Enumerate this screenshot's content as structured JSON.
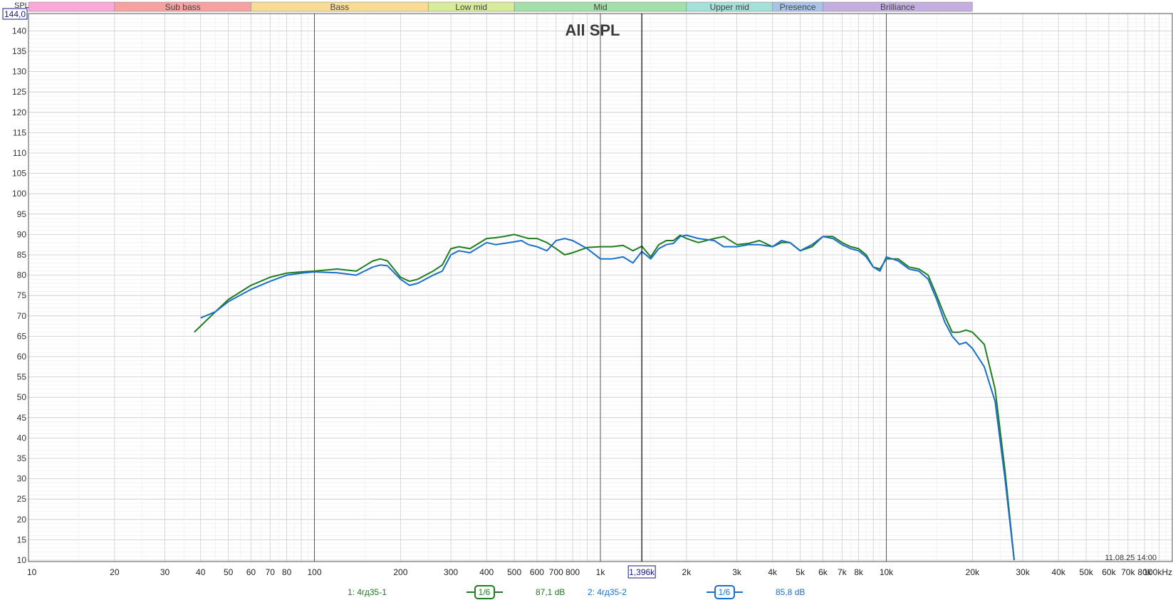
{
  "app": {
    "y_axis_name": "SPL",
    "y_cursor_readout": "144,0",
    "timestamp": "11.08.25 14:00"
  },
  "bands": [
    {
      "label": "",
      "from": 10,
      "to": 20,
      "color": "#f9a8d8"
    },
    {
      "label": "Sub bass",
      "from": 20,
      "to": 60,
      "color": "#f7a1a1"
    },
    {
      "label": "Bass",
      "from": 60,
      "to": 250,
      "color": "#f8dc95"
    },
    {
      "label": "Low mid",
      "from": 250,
      "to": 500,
      "color": "#d7ec9b"
    },
    {
      "label": "Mid",
      "from": 500,
      "to": 2000,
      "color": "#a3e0a9"
    },
    {
      "label": "Upper mid",
      "from": 2000,
      "to": 4000,
      "color": "#a5e0d8"
    },
    {
      "label": "Presence",
      "from": 4000,
      "to": 6000,
      "color": "#a9c3e8"
    },
    {
      "label": "Brilliance",
      "from": 6000,
      "to": 20000,
      "color": "#c3aedf"
    }
  ],
  "chart_data": {
    "type": "line",
    "title": "All SPL",
    "xlabel": "",
    "ylabel": "SPL",
    "x_scale": "log",
    "xlim": [
      10,
      100000
    ],
    "ylim": [
      10,
      144
    ],
    "grid": true,
    "x_ticks": [
      {
        "v": 10,
        "label": "10"
      },
      {
        "v": 20,
        "label": "20"
      },
      {
        "v": 30,
        "label": "30"
      },
      {
        "v": 40,
        "label": "40"
      },
      {
        "v": 50,
        "label": "50"
      },
      {
        "v": 60,
        "label": "60"
      },
      {
        "v": 70,
        "label": "70"
      },
      {
        "v": 80,
        "label": "80"
      },
      {
        "v": 100,
        "label": "100"
      },
      {
        "v": 200,
        "label": "200"
      },
      {
        "v": 300,
        "label": "300"
      },
      {
        "v": 400,
        "label": "400"
      },
      {
        "v": 500,
        "label": "500"
      },
      {
        "v": 600,
        "label": "600"
      },
      {
        "v": 700,
        "label": "700"
      },
      {
        "v": 800,
        "label": "800"
      },
      {
        "v": 1000,
        "label": "1k"
      },
      {
        "v": 2000,
        "label": "2k"
      },
      {
        "v": 3000,
        "label": "3k"
      },
      {
        "v": 4000,
        "label": "4k"
      },
      {
        "v": 5000,
        "label": "5k"
      },
      {
        "v": 6000,
        "label": "6k"
      },
      {
        "v": 7000,
        "label": "7k"
      },
      {
        "v": 8000,
        "label": "8k"
      },
      {
        "v": 10000,
        "label": "10k"
      },
      {
        "v": 20000,
        "label": "20k"
      },
      {
        "v": 30000,
        "label": "30k"
      },
      {
        "v": 40000,
        "label": "40k"
      },
      {
        "v": 50000,
        "label": "50k"
      },
      {
        "v": 60000,
        "label": "60k"
      },
      {
        "v": 70000,
        "label": "70k"
      },
      {
        "v": 80000,
        "label": "80k"
      },
      {
        "v": 100000,
        "label": "100kHz"
      }
    ],
    "y_ticks": [
      140,
      135,
      130,
      125,
      120,
      115,
      110,
      105,
      100,
      95,
      90,
      85,
      80,
      75,
      70,
      65,
      60,
      55,
      50,
      45,
      40,
      35,
      30,
      25,
      20,
      15,
      10
    ],
    "cursor": {
      "x": 1396,
      "label": "1,396k"
    },
    "series": [
      {
        "name": "1: 4гд35-1",
        "color": "#1e7d1e",
        "smoothing": "1/6",
        "cursor_value": "87,1 dB",
        "x": [
          38,
          45,
          50,
          60,
          70,
          80,
          90,
          100,
          120,
          140,
          160,
          170,
          180,
          200,
          215,
          230,
          260,
          280,
          300,
          320,
          350,
          400,
          430,
          460,
          500,
          530,
          560,
          600,
          650,
          700,
          750,
          800,
          900,
          1000,
          1100,
          1200,
          1300,
          1396,
          1500,
          1600,
          1700,
          1800,
          1900,
          2000,
          2200,
          2500,
          2700,
          3000,
          3300,
          3600,
          4000,
          4300,
          4600,
          5000,
          5500,
          6000,
          6500,
          7000,
          7500,
          8000,
          8500,
          9000,
          9500,
          10000,
          11000,
          12000,
          13000,
          14000,
          15000,
          16000,
          17000,
          18000,
          19000,
          20000,
          22000,
          24000,
          26000,
          28000
        ],
        "y": [
          66,
          71,
          74,
          77.5,
          79.5,
          80.5,
          80.8,
          81,
          81.5,
          81,
          83.5,
          84,
          83.5,
          79.5,
          78.5,
          79,
          81,
          82.5,
          86.5,
          87,
          86.5,
          89,
          89.2,
          89.5,
          90,
          89.5,
          89,
          89,
          88,
          86.5,
          85,
          85.5,
          86.8,
          87,
          87,
          87.3,
          86,
          87.1,
          84.5,
          87.5,
          88.5,
          88.5,
          89.8,
          89,
          88,
          89,
          89.5,
          87.5,
          87.8,
          88.5,
          87,
          88,
          88,
          86,
          87,
          89.5,
          89.5,
          88,
          87,
          86.5,
          85,
          82,
          81.5,
          84,
          84,
          82,
          81.5,
          80,
          75,
          70,
          66,
          66,
          66.5,
          66,
          63,
          52,
          32,
          10
        ]
      },
      {
        "name": "2: 4гд35-2",
        "color": "#1a6fc8",
        "smoothing": "1/6",
        "cursor_value": "85,8 dB",
        "x": [
          40,
          45,
          50,
          60,
          70,
          80,
          90,
          100,
          120,
          140,
          160,
          170,
          180,
          200,
          215,
          230,
          260,
          280,
          300,
          320,
          350,
          400,
          430,
          460,
          500,
          530,
          560,
          600,
          650,
          700,
          750,
          800,
          900,
          1000,
          1100,
          1200,
          1300,
          1396,
          1500,
          1600,
          1700,
          1800,
          1900,
          2000,
          2200,
          2500,
          2700,
          3000,
          3300,
          3600,
          4000,
          4300,
          4600,
          5000,
          5500,
          6000,
          6500,
          7000,
          7500,
          8000,
          8500,
          9000,
          9500,
          10000,
          11000,
          12000,
          13000,
          14000,
          15000,
          16000,
          17000,
          18000,
          19000,
          20000,
          22000,
          24000,
          26000,
          28000
        ],
        "y": [
          69.5,
          71,
          73.5,
          76.5,
          78.5,
          80,
          80.5,
          80.8,
          80.6,
          80,
          82,
          82.5,
          82.3,
          79,
          77.5,
          78,
          80,
          81,
          85,
          86,
          85.5,
          88,
          87.5,
          87.8,
          88.2,
          88.5,
          87.5,
          87,
          86,
          88.5,
          89,
          88.5,
          86.5,
          84,
          84,
          84.5,
          83,
          85.8,
          84,
          86.5,
          87.5,
          87.8,
          89.5,
          89.8,
          89,
          88.5,
          87,
          87,
          87.5,
          87.5,
          87,
          88.5,
          88,
          86,
          87.5,
          89.5,
          89,
          87.5,
          86.5,
          86,
          84.5,
          82,
          81,
          84.5,
          83.5,
          81.5,
          81,
          79,
          74,
          68.5,
          65,
          63,
          63.5,
          62,
          57.5,
          49,
          30,
          10
        ]
      }
    ]
  }
}
